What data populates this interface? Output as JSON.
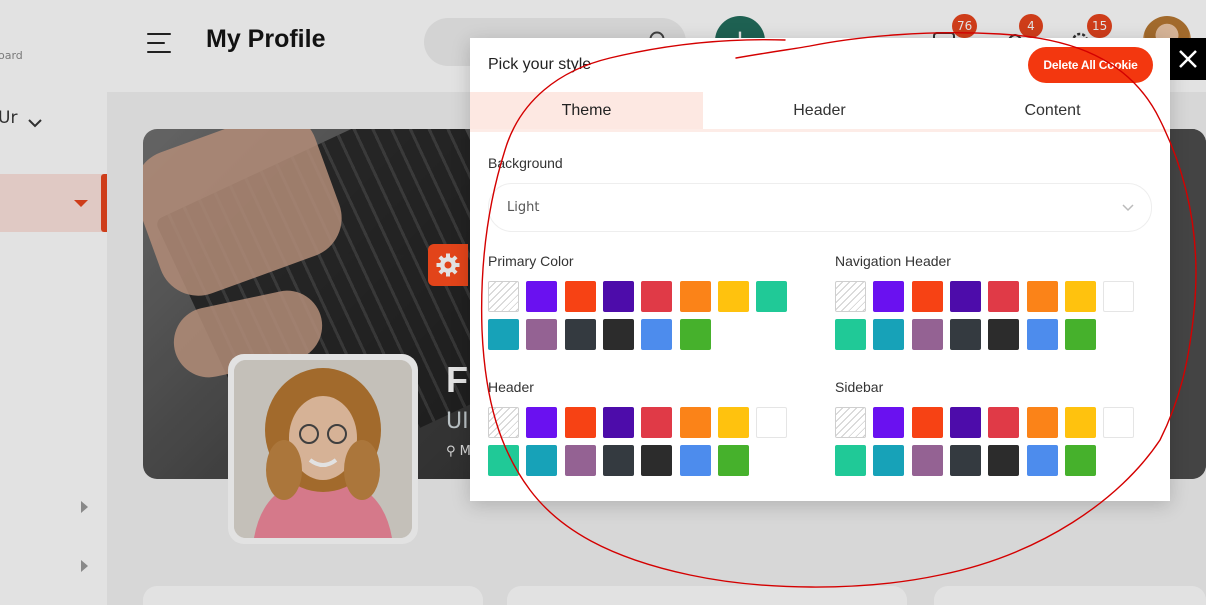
{
  "sidebar": {
    "brand_text": "oard",
    "user_text": "Ur"
  },
  "topbar": {
    "title": "My Profile",
    "badges": {
      "messages": "76",
      "notifications": "4",
      "settings": "15"
    }
  },
  "profile": {
    "name_fragment": "Fr",
    "role_fragment": "UI",
    "location_fragment": "M"
  },
  "style_panel": {
    "title": "Pick your style",
    "delete_button": "Delete All Cookie",
    "close_icon": "close-icon",
    "tabs": [
      "Theme",
      "Header",
      "Content"
    ],
    "active_tab": "Theme",
    "background": {
      "label": "Background",
      "value": "Light"
    },
    "primary_color": {
      "label": "Primary Color",
      "swatches": [
        "none",
        "#6a11f0",
        "#f74214",
        "#4d0caa",
        "#e03a47",
        "#fb8318",
        "#ffc20e",
        "#20c997",
        "#17a2b8",
        "#946293",
        "#343a40",
        "#2c2c2c",
        "#4d8ced",
        "#46b12c"
      ]
    },
    "navigation_header": {
      "label": "Navigation Header",
      "swatches": [
        "none",
        "#6a11f0",
        "#f74214",
        "#4d0caa",
        "#e03a47",
        "#fb8318",
        "#ffc20e",
        "#ffffff",
        "#20c997",
        "#17a2b8",
        "#946293",
        "#343a40",
        "#2c2c2c",
        "#4d8ced",
        "#46b12c"
      ]
    },
    "header": {
      "label": "Header",
      "swatches": [
        "none",
        "#6a11f0",
        "#f74214",
        "#4d0caa",
        "#e03a47",
        "#fb8318",
        "#ffc20e",
        "#ffffff",
        "#20c997",
        "#17a2b8",
        "#946293",
        "#343a40",
        "#2c2c2c",
        "#4d8ced",
        "#46b12c"
      ]
    },
    "sidebar": {
      "label": "Sidebar",
      "swatches": [
        "none",
        "#6a11f0",
        "#f74214",
        "#4d0caa",
        "#e03a47",
        "#fb8318",
        "#ffc20e",
        "#ffffff",
        "#20c997",
        "#17a2b8",
        "#946293",
        "#343a40",
        "#2c2c2c",
        "#4d8ced",
        "#46b12c"
      ]
    }
  },
  "colors": {
    "accent": "#f3370f",
    "annotation": "#d40000"
  }
}
